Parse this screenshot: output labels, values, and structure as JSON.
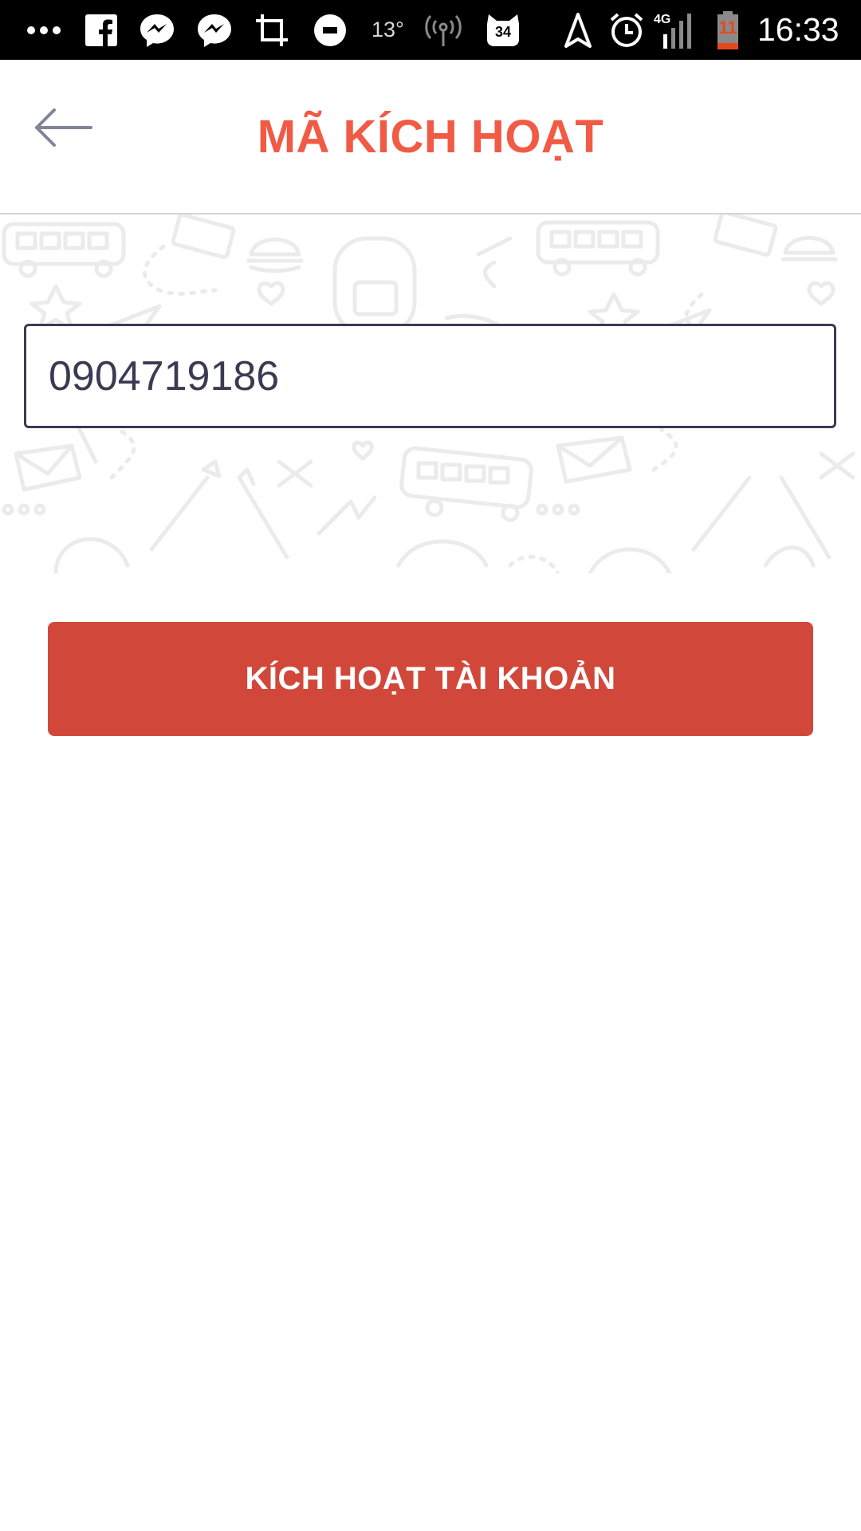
{
  "status_bar": {
    "temperature": "13°",
    "notification_badge": "34",
    "battery_level": "11",
    "time": "16:33",
    "icons": [
      "more-dots-icon",
      "facebook-icon",
      "messenger-icon",
      "messenger-icon",
      "crop-icon",
      "uber-icon",
      "hotspot-icon",
      "cat-app-icon",
      "navigation-icon",
      "alarm-icon",
      "signal-4g-icon",
      "battery-icon"
    ]
  },
  "header": {
    "back_icon": "arrow-left-icon",
    "title": "MÃ KÍCH HOẠT"
  },
  "form": {
    "code_value": "0904719186"
  },
  "actions": {
    "activate_label": "KÍCH HOẠT TÀI KHOẢN"
  },
  "colors": {
    "title": "#f15a45",
    "button": "#d1483b",
    "input_border": "#3a3b52",
    "status_bar": "#000000"
  }
}
